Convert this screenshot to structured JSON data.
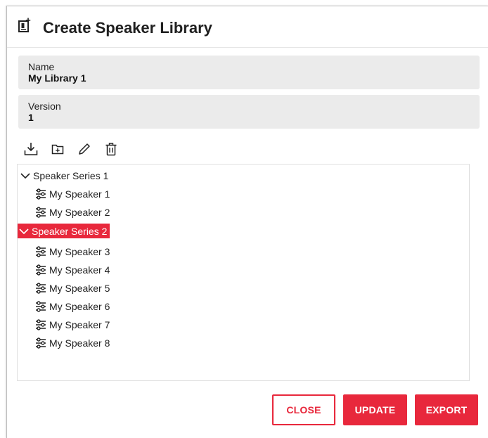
{
  "dialog": {
    "title": "Create Speaker Library",
    "title_icon": "library-add-icon"
  },
  "name_field": {
    "label": "Name",
    "value": "My Library 1"
  },
  "version_field": {
    "label": "Version",
    "value": "1"
  },
  "toolbar": {
    "icons": [
      "download-icon",
      "new-folder-icon",
      "edit-pencil-icon",
      "delete-trash-icon"
    ]
  },
  "tree": {
    "series": [
      {
        "label": "Speaker Series 1",
        "selected": false,
        "speakers": [
          "My Speaker 1",
          "My Speaker 2"
        ]
      },
      {
        "label": "Speaker Series 2",
        "selected": true,
        "speakers": [
          "My Speaker 3",
          "My Speaker 4",
          "My Speaker 5",
          "My Speaker 6",
          "My Speaker 7",
          "My Speaker 8"
        ]
      }
    ]
  },
  "buttons": {
    "close": "CLOSE",
    "update": "UPDATE",
    "export": "EXPORT"
  },
  "colors": {
    "accent": "#e8283c",
    "field_bg": "#ebebeb"
  }
}
